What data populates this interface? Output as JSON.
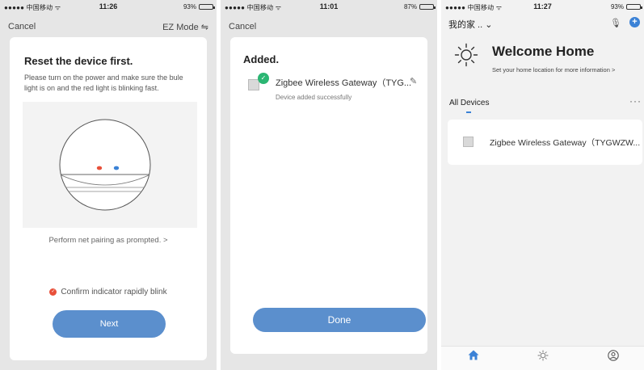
{
  "status": {
    "carrier": "●●●●● 中国移动 ᯤ",
    "p1_time": "11:26",
    "p1_battery": "93%",
    "p2_time": "11:01",
    "p2_battery": "87%",
    "p3_time": "11:27",
    "p3_battery": "93%",
    "battery_levels": [
      0.93,
      0.87,
      0.93
    ]
  },
  "screen1": {
    "cancel": "Cancel",
    "mode": "EZ Mode ⇋",
    "title": "Reset the device first.",
    "description": "Please turn on the power and make sure the bule light is on and the red light is blinking fast.",
    "pair_link": "Perform net pairing as prompted. >",
    "confirm": "Confirm indicator rapidly blink",
    "next": "Next"
  },
  "screen2": {
    "cancel": "Cancel",
    "title": "Added.",
    "device_name": "Zigbee Wireless Gateway（TYG...",
    "device_status": "Device added successfully",
    "done": "Done"
  },
  "screen3": {
    "home": "我的家 .. ⌄",
    "welcome": "Welcome Home",
    "location": "Set your home location for more information  >",
    "all_devices": "All Devices",
    "more": "···",
    "device_name": "Zigbee Wireless Gateway（TYGWZW..."
  },
  "colors": {
    "accent": "#5b8fcd",
    "success": "#2bb673",
    "alert": "#e8503a",
    "indicator_red": "#e8503a",
    "indicator_blue": "#3b82d6"
  },
  "icons": {
    "tab_home": "home-icon",
    "tab_scene": "sun-icon",
    "tab_me": "profile-icon"
  }
}
